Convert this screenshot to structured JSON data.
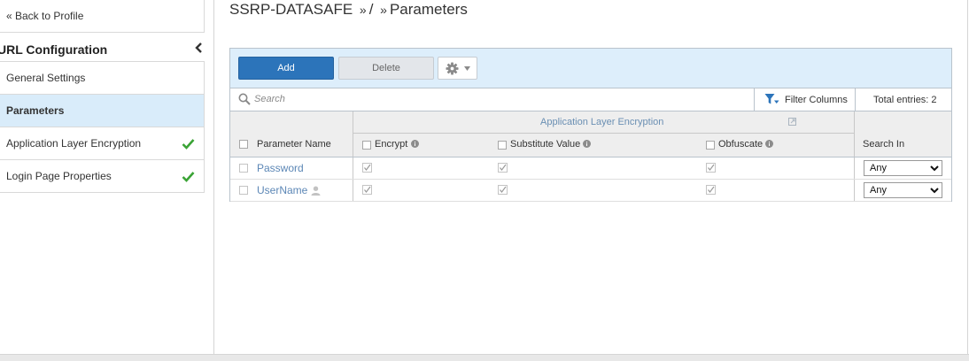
{
  "sidebar": {
    "back_link": "« Back to Profile",
    "section_title": "URL Configuration",
    "items": [
      {
        "label": "General Settings",
        "active": false,
        "check": false
      },
      {
        "label": "Parameters",
        "active": true,
        "check": false
      },
      {
        "label": "Application Layer Encryption",
        "active": false,
        "check": true
      },
      {
        "label": "Login Page Properties",
        "active": false,
        "check": true
      }
    ]
  },
  "breadcrumb": {
    "root": "SSRP-DATASAFE",
    "sep1": "»",
    "middle": "/",
    "sep2": "»",
    "current": "Parameters"
  },
  "toolbar": {
    "add_label": "Add",
    "delete_label": "Delete"
  },
  "search": {
    "placeholder": "Search",
    "filter_label": "Filter Columns",
    "total_label": "Total entries: 2"
  },
  "table": {
    "col_name": "Parameter Name",
    "group_label": "Application Layer Encryption",
    "col_encrypt": "Encrypt",
    "col_substitute": "Substitute Value",
    "col_obfuscate": "Obfuscate",
    "col_search_in": "Search In",
    "rows": [
      {
        "name": "Password",
        "encrypt": true,
        "substitute": true,
        "obfuscate": true,
        "search_in": "Any",
        "user_icon": false
      },
      {
        "name": "UserName",
        "encrypt": true,
        "substitute": true,
        "obfuscate": true,
        "search_in": "Any",
        "user_icon": true
      }
    ],
    "search_in_options": [
      "Any"
    ]
  },
  "colors": {
    "accent": "#2c74ba",
    "active_row": "#d9ecfa",
    "toolbar_bg": "#ddeefb",
    "check_green": "#3aa335",
    "link": "#5c87b6"
  }
}
